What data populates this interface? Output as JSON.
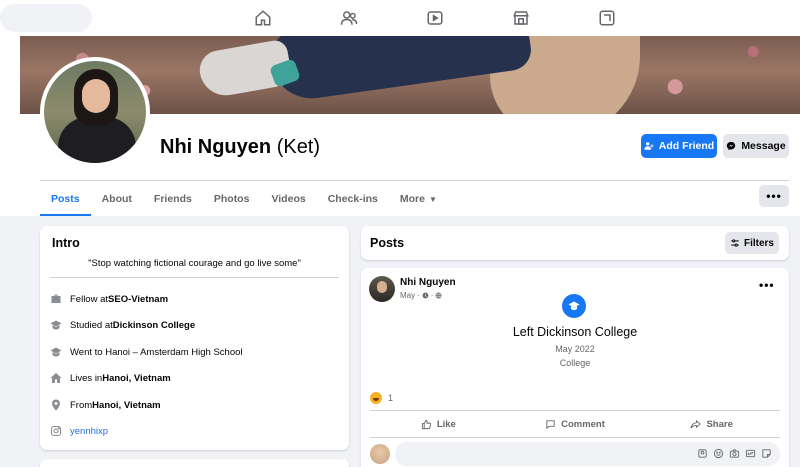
{
  "nav": {
    "icons": [
      "home-icon",
      "friends-icon",
      "watch-icon",
      "marketplace-icon",
      "gaming-icon"
    ]
  },
  "profile": {
    "name": "Nhi Nguyen",
    "alt_name": "(Ket)",
    "add_friend_label": "Add Friend",
    "message_label": "Message"
  },
  "tabs": {
    "items": [
      {
        "label": "Posts",
        "active": true
      },
      {
        "label": "About"
      },
      {
        "label": "Friends"
      },
      {
        "label": "Photos"
      },
      {
        "label": "Videos"
      },
      {
        "label": "Check-ins"
      },
      {
        "label": "More"
      }
    ],
    "more_button": "•••"
  },
  "intro": {
    "title": "Intro",
    "bio": "\"Stop watching fictional courage and go live some\"",
    "items": [
      {
        "icon": "work-icon",
        "prefix": "Fellow at ",
        "bold": "SEO-Vietnam"
      },
      {
        "icon": "education-icon",
        "prefix": "Studied at ",
        "bold": "Dickinson College"
      },
      {
        "icon": "education-icon",
        "prefix": "Went to Hanoi – Amsterdam High School",
        "bold": ""
      },
      {
        "icon": "home-icon",
        "prefix": "Lives in ",
        "bold": "Hanoi, Vietnam"
      },
      {
        "icon": "location-icon",
        "prefix": "From ",
        "bold": "Hanoi, Vietnam"
      },
      {
        "icon": "instagram-icon",
        "prefix": "",
        "bold": "",
        "link": "yennhixp"
      }
    ]
  },
  "posts": {
    "title": "Posts",
    "filters_label": "Filters"
  },
  "post": {
    "author": "Nhi Nguyen",
    "date": "May",
    "event_title": "Left Dickinson College",
    "event_date": "May 2022",
    "event_type": "College",
    "reaction_count": "1",
    "actions": {
      "like": "Like",
      "comment": "Comment",
      "share": "Share"
    },
    "dots": "•••"
  },
  "colors": {
    "accent": "#1877f2",
    "background": "#f0f2f5",
    "secondary_text": "#65676b",
    "link": "#216fdb"
  }
}
